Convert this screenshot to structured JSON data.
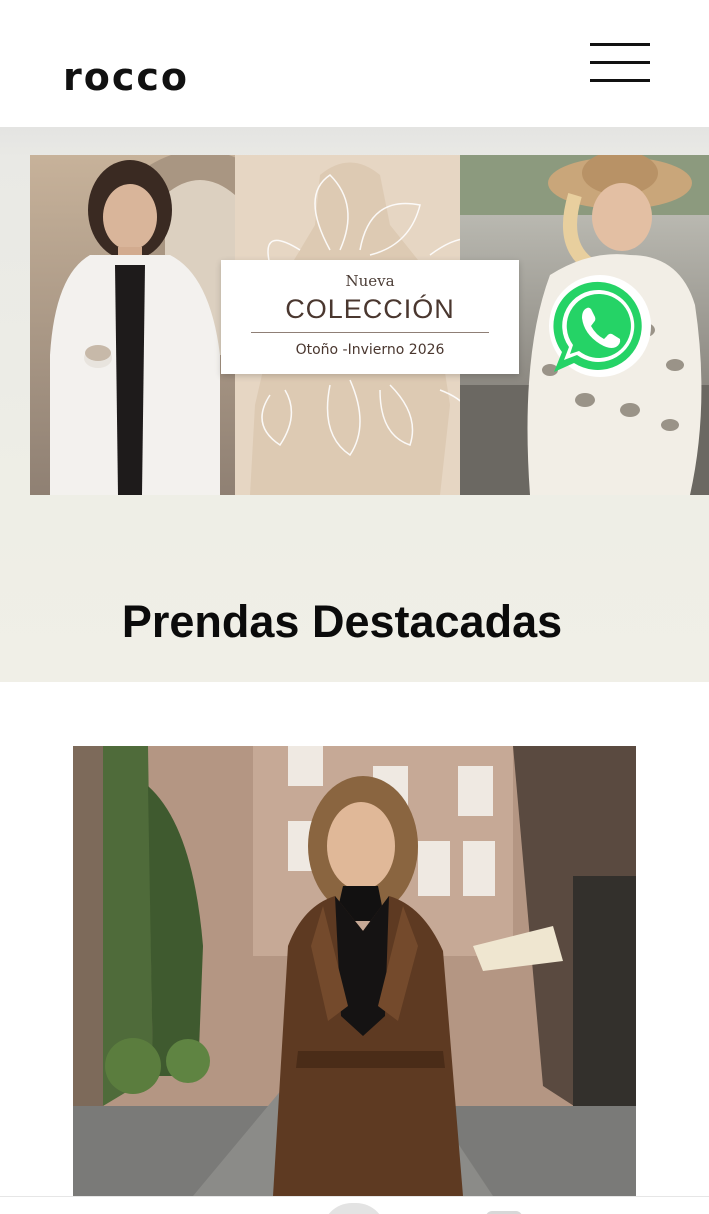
{
  "header": {
    "logo": "rocco",
    "menu_icon": "hamburger-menu-icon"
  },
  "banner": {
    "promo_small": "Nueva",
    "promo_title": "COLECCIÓN",
    "promo_subtitle": "Otoño -Invierno 2026",
    "whatsapp_icon": "whatsapp-icon",
    "whatsapp_color": "#25D366"
  },
  "section": {
    "title": "Prendas Destacadas"
  },
  "colors": {
    "hero_background": "#eeeee6",
    "text_dark": "#0b0b0b"
  }
}
